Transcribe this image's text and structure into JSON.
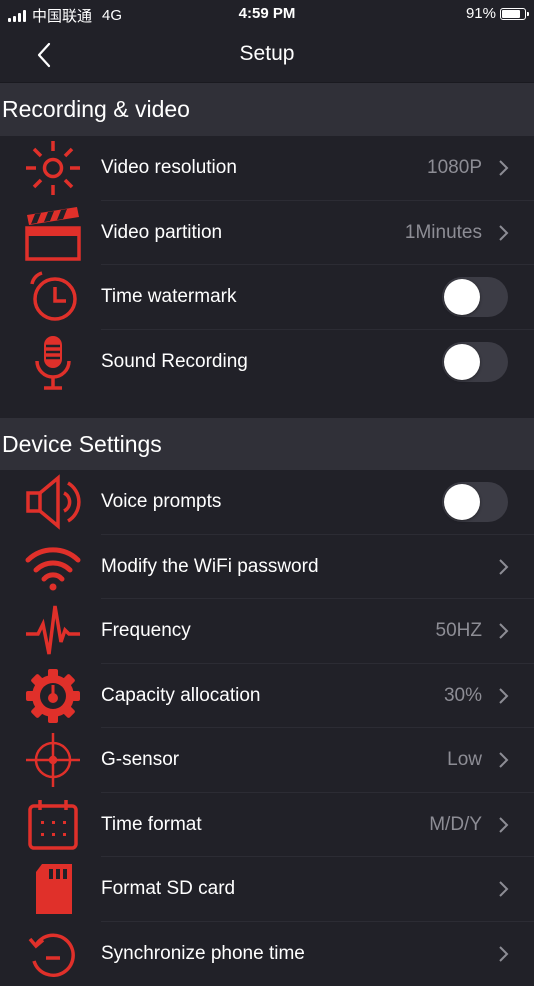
{
  "status_bar": {
    "carrier": "中国联通",
    "network": "4G",
    "time": "4:59 PM",
    "battery": "91%",
    "battery_level": 0.91
  },
  "nav": {
    "title": "Setup",
    "back_icon": "chevron-left-icon"
  },
  "colors": {
    "accent": "#e0302a",
    "background": "#212128",
    "section": "#303038",
    "value_text": "#8d8d95"
  },
  "sections": {
    "recording": {
      "title": "Recording & video",
      "rows": [
        {
          "label": "Video resolution",
          "value": "1080P",
          "icon": "brightness-icon"
        },
        {
          "label": "Video partition",
          "value": "1Minutes",
          "icon": "clapperboard-icon"
        },
        {
          "label": "Time watermark",
          "icon": "alarm-clock-icon",
          "toggle": false
        },
        {
          "label": "Sound Recording",
          "icon": "microphone-icon",
          "toggle": false
        }
      ]
    },
    "device": {
      "title": "Device Settings",
      "rows": [
        {
          "label": "Voice prompts",
          "icon": "speaker-icon",
          "toggle": false
        },
        {
          "label": "Modify the WiFi password",
          "icon": "wifi-icon"
        },
        {
          "label": "Frequency",
          "value": "50HZ",
          "icon": "waveform-icon"
        },
        {
          "label": "Capacity allocation",
          "value": "30%",
          "icon": "gear-gauge-icon"
        },
        {
          "label": "G-sensor",
          "value": "Low",
          "icon": "crosshair-icon"
        },
        {
          "label": "Time format",
          "value": "M/D/Y",
          "icon": "calendar-icon"
        },
        {
          "label": "Format SD card",
          "icon": "sd-card-icon"
        },
        {
          "label": "Synchronize phone time",
          "icon": "sync-clock-icon"
        }
      ]
    }
  }
}
